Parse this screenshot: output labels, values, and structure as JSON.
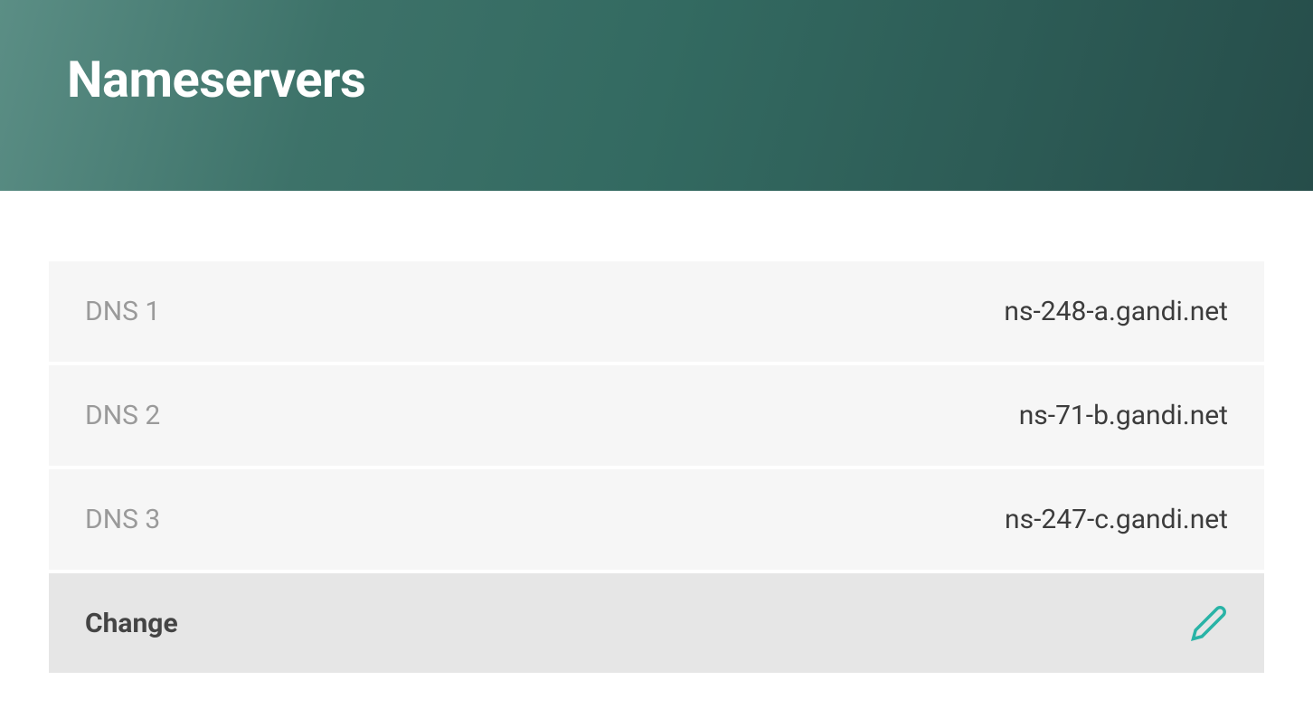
{
  "header": {
    "title": "Nameservers"
  },
  "dns": [
    {
      "label": "DNS 1",
      "value": "ns-248-a.gandi.net"
    },
    {
      "label": "DNS 2",
      "value": "ns-71-b.gandi.net"
    },
    {
      "label": "DNS 3",
      "value": "ns-247-c.gandi.net"
    }
  ],
  "actions": {
    "change_label": "Change"
  },
  "colors": {
    "accent": "#29b3a6",
    "header_gradient_start": "#5b8e85",
    "header_gradient_end": "#264d4a"
  }
}
